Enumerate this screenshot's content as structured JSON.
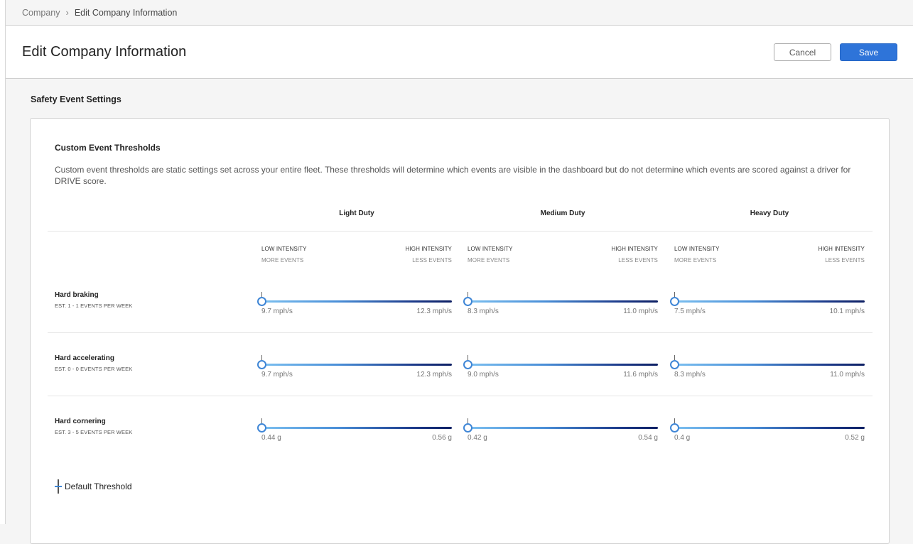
{
  "breadcrumb": {
    "parent": "Company",
    "current": "Edit Company Information"
  },
  "header": {
    "title": "Edit Company Information",
    "cancel_label": "Cancel",
    "save_label": "Save"
  },
  "section": {
    "title": "Safety Event Settings"
  },
  "card": {
    "title": "Custom Event Thresholds",
    "description": "Custom event thresholds are static settings set across your entire fleet. These thresholds will determine which events are visible in the dashboard but do not determine which events are scored against a driver for DRIVE score.",
    "columns": [
      "Light Duty",
      "Medium Duty",
      "Heavy Duty"
    ],
    "intensity": {
      "low": "LOW INTENSITY",
      "low_sub": "MORE EVENTS",
      "high": "HIGH INTENSITY",
      "high_sub": "LESS EVENTS"
    },
    "rows": [
      {
        "name": "Hard braking",
        "estimate": "EST. 1 - 1 EVENTS PER WEEK",
        "sliders": [
          {
            "min": "9.7 mph/s",
            "max": "12.3 mph/s",
            "value": 0
          },
          {
            "min": "8.3 mph/s",
            "max": "11.0 mph/s",
            "value": 0
          },
          {
            "min": "7.5 mph/s",
            "max": "10.1 mph/s",
            "value": 0
          }
        ]
      },
      {
        "name": "Hard accelerating",
        "estimate": "EST. 0 - 0 EVENTS PER WEEK",
        "sliders": [
          {
            "min": "9.7 mph/s",
            "max": "12.3 mph/s",
            "value": 0
          },
          {
            "min": "9.0 mph/s",
            "max": "11.6 mph/s",
            "value": 0
          },
          {
            "min": "8.3 mph/s",
            "max": "11.0 mph/s",
            "value": 0
          }
        ]
      },
      {
        "name": "Hard cornering",
        "estimate": "EST. 3 - 5 EVENTS PER WEEK",
        "sliders": [
          {
            "min": "0.44 g",
            "max": "0.56 g",
            "value": 0
          },
          {
            "min": "0.42 g",
            "max": "0.54 g",
            "value": 0
          },
          {
            "min": "0.4 g",
            "max": "0.52 g",
            "value": 0
          }
        ]
      }
    ],
    "legend": {
      "label": "Default Threshold"
    },
    "colors": {
      "accent": "#2e74d9",
      "track_start": "#7cc0f0",
      "track_end": "#0d1f63"
    }
  }
}
